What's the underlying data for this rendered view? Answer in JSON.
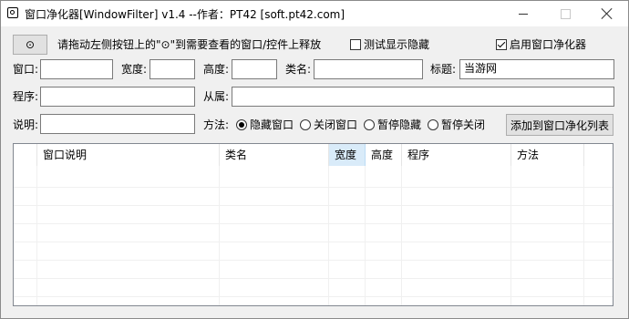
{
  "window": {
    "title": "窗口净化器[WindowFilter] v1.4 --作者：PT42 [soft.pt42.com]"
  },
  "top": {
    "drag_button_label": "⊙",
    "instruction": "请拖动左侧按钮上的\"⊙\"到需要查看的窗口/控件上释放",
    "show_hidden_label": "测试显示隐藏",
    "show_hidden_checked": false,
    "enable_label": "启用窗口净化器",
    "enable_checked": true
  },
  "fields": {
    "window_label": "窗口:",
    "window_value": "",
    "width_label": "宽度:",
    "width_value": "",
    "height_label": "高度:",
    "height_value": "",
    "class_label": "类名:",
    "class_value": "",
    "title_label": "标题:",
    "title_value": "当游网",
    "program_label": "程序:",
    "program_value": "",
    "owner_label": "从属:",
    "owner_value": "",
    "desc_label": "说明:",
    "desc_value": "",
    "method_label": "方法:"
  },
  "methods": [
    {
      "label": "隐藏窗口",
      "selected": true
    },
    {
      "label": "关闭窗口",
      "selected": false
    },
    {
      "label": "暂停隐藏",
      "selected": false
    },
    {
      "label": "暂停关闭",
      "selected": false
    }
  ],
  "add_button_label": "添加到窗口净化列表",
  "table": {
    "columns": [
      "窗口说明",
      "类名",
      "宽度",
      "高度",
      "程序",
      "方法"
    ],
    "sorted_column": "宽度",
    "rows": []
  },
  "colors": {
    "header_selected": "#d9ebf9",
    "window_bg": "#f0f0f0"
  }
}
